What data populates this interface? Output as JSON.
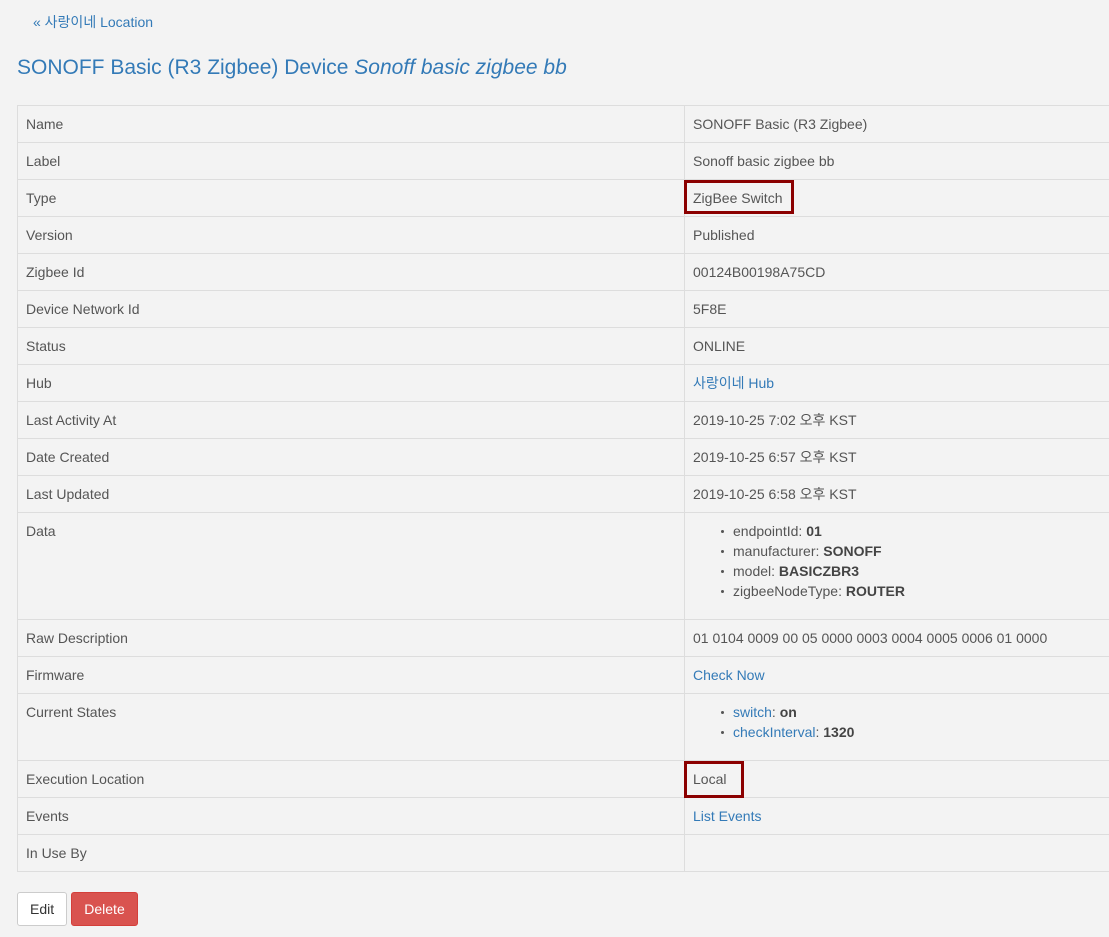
{
  "back_link": "« 사랑이네 Location",
  "title": {
    "prefix": "SONOFF Basic (R3 Zigbee) Device ",
    "label": "Sonoff basic zigbee bb"
  },
  "rows": {
    "name": {
      "key": "Name",
      "value": "SONOFF Basic (R3 Zigbee)"
    },
    "label": {
      "key": "Label",
      "value": "Sonoff basic zigbee bb"
    },
    "type": {
      "key": "Type",
      "value": "ZigBee Switch"
    },
    "version": {
      "key": "Version",
      "value": "Published"
    },
    "zigbee_id": {
      "key": "Zigbee Id",
      "value": "00124B00198A75CD"
    },
    "network_id": {
      "key": "Device Network Id",
      "value": "5F8E"
    },
    "status": {
      "key": "Status",
      "value": "ONLINE"
    },
    "hub": {
      "key": "Hub",
      "value": "사랑이네 Hub"
    },
    "last_activity": {
      "key": "Last Activity At",
      "value": "2019-10-25 7:02 오후 KST"
    },
    "date_created": {
      "key": "Date Created",
      "value": "2019-10-25 6:57 오후 KST"
    },
    "last_updated": {
      "key": "Last Updated",
      "value": "2019-10-25 6:58 오후 KST"
    },
    "data": {
      "key": "Data",
      "items": [
        {
          "name": "endpointId",
          "value": "01"
        },
        {
          "name": "manufacturer",
          "value": "SONOFF"
        },
        {
          "name": "model",
          "value": "BASICZBR3"
        },
        {
          "name": "zigbeeNodeType",
          "value": "ROUTER"
        }
      ]
    },
    "raw_description": {
      "key": "Raw Description",
      "value": "01 0104 0009 00 05 0000 0003 0004 0005 0006 01 0000"
    },
    "firmware": {
      "key": "Firmware",
      "value": "Check Now"
    },
    "current_states": {
      "key": "Current States",
      "items": [
        {
          "name": "switch",
          "value": "on"
        },
        {
          "name": "checkInterval",
          "value": "1320"
        }
      ]
    },
    "execution_location": {
      "key": "Execution Location",
      "value": "Local"
    },
    "events": {
      "key": "Events",
      "value": "List Events"
    },
    "in_use_by": {
      "key": "In Use By",
      "value": ""
    }
  },
  "buttons": {
    "edit": "Edit",
    "delete": "Delete"
  },
  "colors": {
    "link": "#337ab7",
    "highlight": "#8b0000",
    "danger": "#d9534f"
  }
}
